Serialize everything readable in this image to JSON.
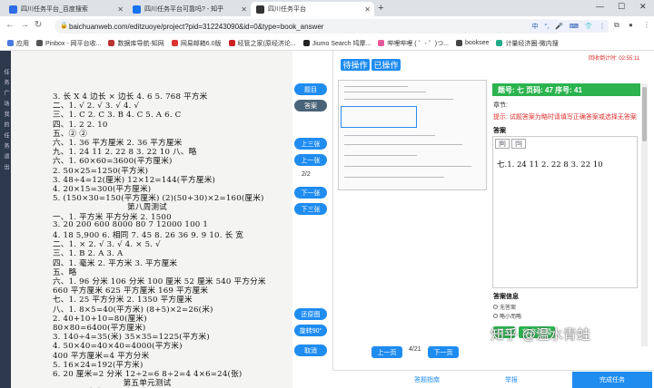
{
  "tabs": [
    {
      "label": "四川任务平台_百度搜索",
      "color": "#2e6be6"
    },
    {
      "label": "四川任务平台可靠吗? - 知乎",
      "color": "#1772f6"
    },
    {
      "label": "四川任务平台",
      "color": "#333333"
    }
  ],
  "address": {
    "url": "baichuanweb.com/editzuoye/project?pid=312243090&id=0&type=book_answer"
  },
  "ime": {
    "items": [
      "中",
      "°,",
      "🎤",
      "⌨",
      "👕",
      "⋮"
    ]
  },
  "bookmarks": [
    "应用",
    "Pinbox - 网平台收...",
    "数据库导航-知网",
    "网易邮箱6.0版",
    "经管之家(原经济论...",
    "Jiumo Search 鸠摩...",
    "哔哩哔哩 ( ゜- ゜)つ...",
    "booksee",
    "计量经济圈-微内搜"
  ],
  "left_strip": {
    "text": "任 务 广 场 我 的 任 务 退 出"
  },
  "doc": {
    "lines": [
      "3. 长 X 4   边长 × 边长   4.  6    5.  768 平方米",
      "二、1. √    2. √    3. √    4. √",
      "三、1.  C   2.  C   3.  B   4.  C   5.  A   6.  C",
      "四、1.  2   2.  10",
      "五、②    ②",
      "六、1.  36 平方厘米      2.  36 平方厘米",
      "九、1.  24   11   2.  22   8   3.  22   10        八、略",
      "六、1.  60×60=3600(平方厘米)",
      "     2.  50×25=1250(平方米)",
      "     3.  48÷4=12(厘米)    12×12=144(平方厘米)",
      "     4.  20×15=300(平方厘米)",
      "     5.  (150×30=150(平方厘米)   (2)(50+30)×2=160(厘米)",
      "第八周测试",
      "一、1.  平方米    平方分米   2.  1500",
      "     3.  20    200    600    8000    80    7    12000    100    1",
      "     4.  18    5,900     6.  相同   7.  45     8.  26    36    9.  9   10.  长    宽",
      "二、1.  ×    2.  √    3.  √    4.  ×    5.  √",
      "三、1.  B    2.  A    3.  A",
      "四、1.  毫米    2.  平方米    3.  平方厘米",
      "五、略",
      "六、1.  96 分米    106 分米    100 厘米    52 厘米    540 平方分米",
      "         660 平方厘米    625 平方厘米    169 平方厘米",
      "七、1.  25 平方分米    2.  1350 平方厘米",
      "八、1.  8×5=40(平方米)   (8+5)×2=26(米)",
      "     2.  40+10+10=80(厘米)",
      "         80×80=6400(平方厘米)",
      "     3.  140÷4=35(米)    35×35=1225(平方米)",
      "     4.  50×40=40×40=4000(平方米)",
      "         400 平方厘米=4 平方分米",
      "     5.  16×24=192(平方米)",
      "     6.  20 厘米=2 分米    12÷2=6    8÷2=4    4×6=24(张)",
      "第五单元测试",
      "一、1.  平方米  2.  平方厘米   100"
    ]
  },
  "controls": {
    "topic": "题目",
    "answer": "答案",
    "prev3": "上三张",
    "prev1": "上一张",
    "page": "2/2",
    "next1": "下一张",
    "next3": "下三张",
    "restore": "还原图",
    "rotate": "旋转90°",
    "cancel": "取消"
  },
  "middle": {
    "op1": "待操作",
    "op2": "已操作",
    "prev": "上一页",
    "page": "4/21",
    "next": "下一页"
  },
  "right": {
    "timer": "回收倒计时:  02:55:11",
    "qhead": "题号: 七 页码: 47 序号: 41",
    "chapter": "章节:",
    "hint": "提示: 试题答案为略时请填写正确答案或选择无答案",
    "ans_label": "答案",
    "tools": [
      "[B]",
      "[S]"
    ],
    "ans_text": "七.1. 24    11    2. 22    8    3. 22    10",
    "ans_info": "答案信息",
    "radio1": "无答案",
    "radio2": "略小而略",
    "submit": "提交",
    "abandon": "放弃编辑"
  },
  "bottom": {
    "guide": "答题指南",
    "report": "举报",
    "finish": "完成任务"
  },
  "watermark": "知乎 @温水青蛙"
}
